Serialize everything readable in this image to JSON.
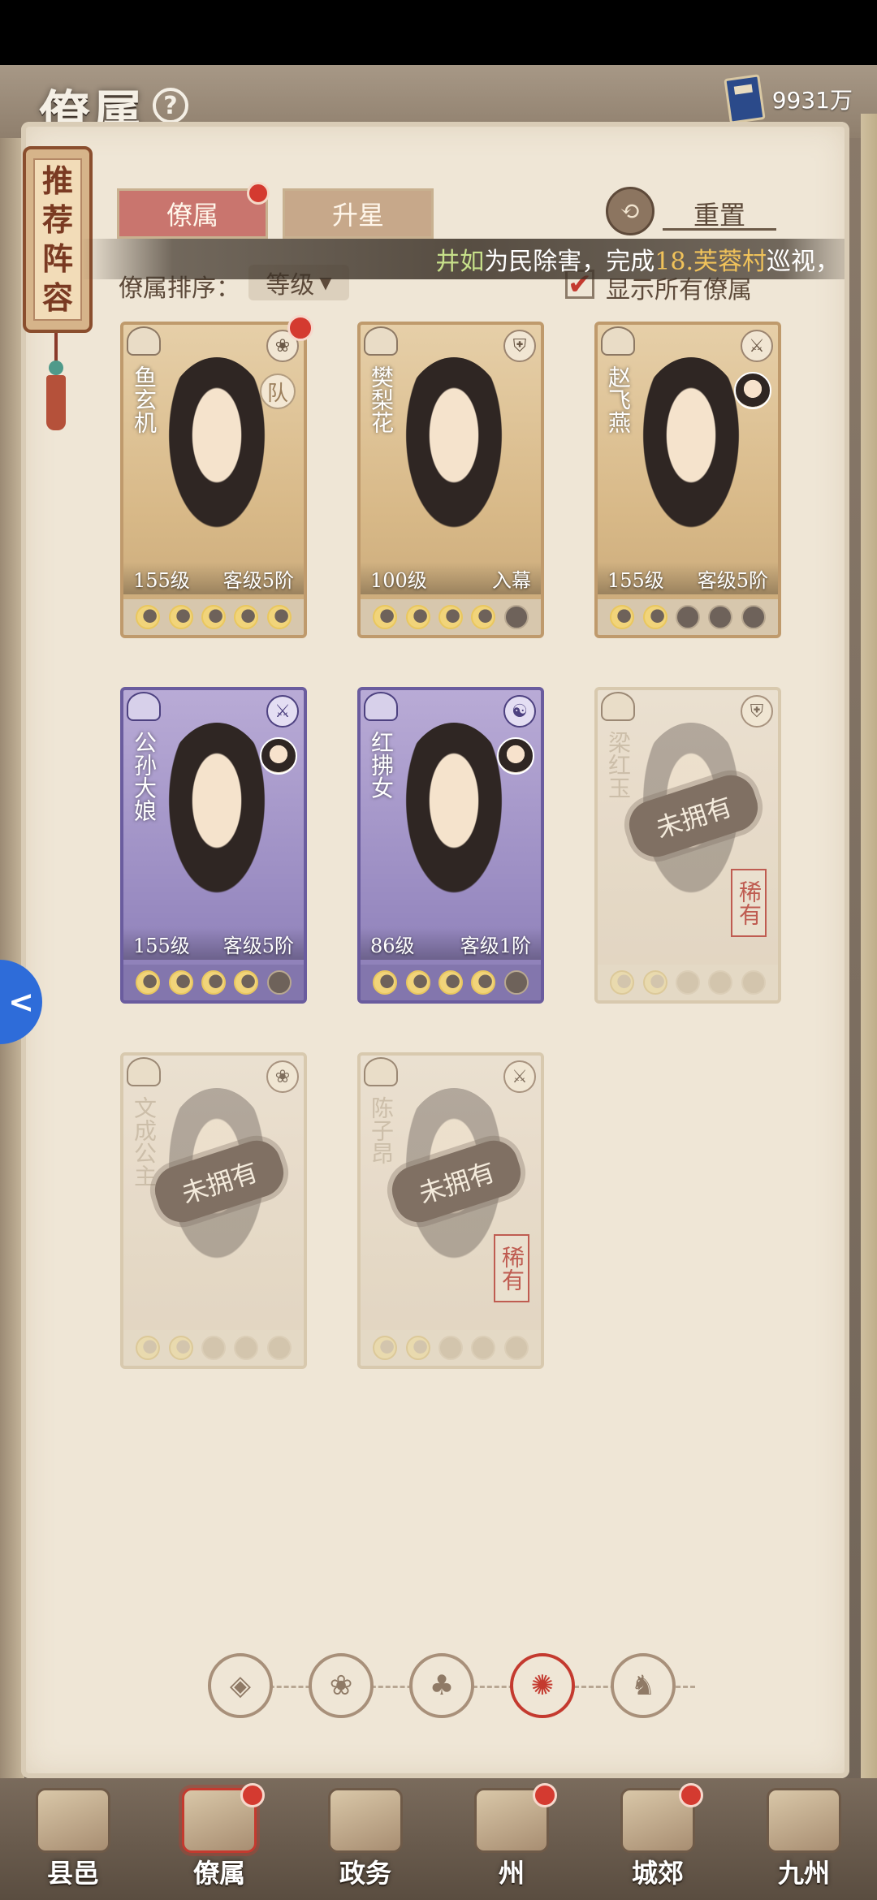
{
  "header": {
    "title": "僚属",
    "help_glyph": "?",
    "currency_value": "9931万"
  },
  "side_scroll": {
    "chars": [
      "推",
      "荐",
      "阵",
      "容"
    ]
  },
  "tabs": [
    {
      "label": "僚属",
      "active": true,
      "has_dot": true
    },
    {
      "label": "升星",
      "active": false,
      "has_dot": false
    }
  ],
  "reset_label": "重置",
  "announcement": {
    "name": "井如",
    "text1": "为民除害，完成",
    "place": "18.芙蓉村",
    "text2": "巡视，"
  },
  "sort": {
    "label": "僚属排序：",
    "value": "等级",
    "arrow": "▼"
  },
  "show_all": {
    "checked": true,
    "check_glyph": "✔",
    "label": "显示所有僚属"
  },
  "cards": [
    {
      "name": "鱼玄机",
      "style": "normal",
      "level": "155级",
      "rank": "客级5阶",
      "stars_on": 5,
      "badge": "队",
      "red_dot": true,
      "type_icon": "lotus-icon",
      "type_glyph": "❀"
    },
    {
      "name": "樊梨花",
      "style": "normal",
      "level": "100级",
      "rank": "入幕",
      "stars_on": 4,
      "badge": "",
      "red_dot": false,
      "type_icon": "shield-icon",
      "type_glyph": "⛨"
    },
    {
      "name": "赵飞燕",
      "style": "normal",
      "level": "155级",
      "rank": "客级5阶",
      "stars_on": 2,
      "badge": "avatar",
      "red_dot": false,
      "type_icon": "sword-icon",
      "type_glyph": "⚔"
    },
    {
      "name": "公孙大娘",
      "style": "purple",
      "level": "155级",
      "rank": "客级5阶",
      "stars_on": 4,
      "badge": "avatar",
      "red_dot": false,
      "type_icon": "sword-icon",
      "type_glyph": "⚔"
    },
    {
      "name": "红拂女",
      "style": "purple",
      "level": "86级",
      "rank": "客级1阶",
      "stars_on": 4,
      "badge": "avatar",
      "red_dot": false,
      "type_icon": "yinyang-icon",
      "type_glyph": "☯"
    },
    {
      "name": "梁红玉",
      "style": "locked",
      "locked_text": "未拥有",
      "rare": "稀有",
      "stars_on": 2,
      "type_icon": "shield-icon",
      "type_glyph": "⛨"
    },
    {
      "name": "文成公主",
      "style": "locked",
      "locked_text": "未拥有",
      "rare": "",
      "stars_on": 2,
      "type_icon": "lotus-icon",
      "type_glyph": "❀"
    },
    {
      "name": "陈子昂",
      "style": "locked",
      "locked_text": "未拥有",
      "rare": "稀有",
      "stars_on": 2,
      "type_icon": "sword-icon",
      "type_glyph": "⚔"
    }
  ],
  "filters": [
    {
      "name": "all-filter-icon",
      "glyph": "◈",
      "active": false
    },
    {
      "name": "lotus-filter-icon",
      "glyph": "❀",
      "active": false
    },
    {
      "name": "gourd-filter-icon",
      "glyph": "♣",
      "active": false
    },
    {
      "name": "fan-filter-icon",
      "glyph": "✺",
      "active": true
    },
    {
      "name": "beast-filter-icon",
      "glyph": "♞",
      "active": false
    }
  ],
  "bottom_nav": [
    {
      "label": "县邑",
      "dot": false,
      "active": false
    },
    {
      "label": "僚属",
      "dot": true,
      "active": true
    },
    {
      "label": "政务",
      "dot": false,
      "active": false
    },
    {
      "label": "州",
      "dot": true,
      "active": false
    },
    {
      "label": "城郊",
      "dot": true,
      "active": false
    },
    {
      "label": "九州",
      "dot": false,
      "active": false
    }
  ],
  "float_button_glyph": "<"
}
